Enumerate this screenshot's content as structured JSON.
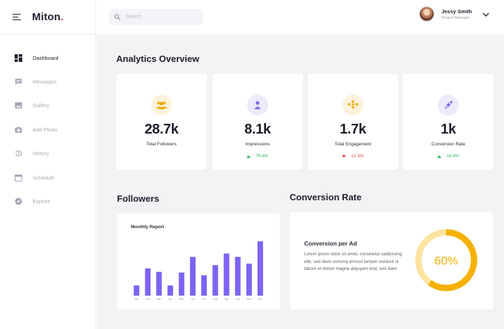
{
  "brand": {
    "name": "Miton",
    "dot": "."
  },
  "sidebar": {
    "items": [
      {
        "label": "Dashboard",
        "icon": "dashboard-icon",
        "active": true
      },
      {
        "label": "Messages",
        "icon": "message-icon",
        "active": false
      },
      {
        "label": "Gallery",
        "icon": "image-icon",
        "active": false
      },
      {
        "label": "Add Photo",
        "icon": "camera-icon",
        "active": false
      },
      {
        "label": "History",
        "icon": "history-icon",
        "active": false
      },
      {
        "label": "Schedule",
        "icon": "calendar-icon",
        "active": false
      },
      {
        "label": "Explore",
        "icon": "compass-icon",
        "active": false
      }
    ]
  },
  "header": {
    "search_placeholder": "Search",
    "user": {
      "name": "Jessy Smith",
      "role": "Project Manager"
    }
  },
  "main": {
    "title": "Analytics Overview",
    "stats": [
      {
        "value": "28.7k",
        "label": "Total Followers",
        "delta": "",
        "trend": "none",
        "icon": "users-icon",
        "icon_bg": "#fdf3dc",
        "icon_color": "#f1b51c"
      },
      {
        "value": "8.1k",
        "label": "Impressions",
        "delta": "78.8%",
        "trend": "up",
        "icon": "person-icon",
        "icon_bg": "#ecebfb",
        "icon_color": "#7b68e8"
      },
      {
        "value": "1.7k",
        "label": "Total Engagement",
        "delta": "12.3%",
        "trend": "down",
        "icon": "group-icon",
        "icon_bg": "#fdf3dc",
        "icon_color": "#f1b51c"
      },
      {
        "value": "1k",
        "label": "Conversion Rate",
        "delta": "18.8%",
        "trend": "up",
        "icon": "rocket-icon",
        "icon_bg": "#ecebfb",
        "icon_color": "#7b68e8"
      }
    ],
    "followers_title": "Followers",
    "conversion_title": "Conversion Rate"
  },
  "chart_data": {
    "type": "bar",
    "title": "Monthly Report",
    "categories": [
      "Jan",
      "Feb",
      "Mar",
      "Apr",
      "May",
      "Jun",
      "Jul",
      "Aug",
      "Sep",
      "Oct",
      "Nov",
      "Dec"
    ],
    "values": [
      15,
      40,
      35,
      15,
      34,
      57,
      30,
      45,
      62,
      57,
      47,
      80
    ],
    "ylim": [
      0,
      85
    ],
    "grid": false,
    "bar_color": "#7e63f4"
  },
  "conversion": {
    "heading": "Conversion per Ad",
    "text": "Lorem ipsum dolor sit amet, consetetur sadipscing elitr, sed diam nonumy eirmod tempor invidunt ut labore et dolore magna aliquyam erat, sed diam",
    "percent": 60,
    "percent_label": "60%",
    "color": "#f5b100",
    "track_color": "#fde4a0"
  },
  "colors": {
    "up": "#2dbd5f",
    "down": "#e74c4c",
    "accent": "#7e63f4",
    "brand_dot": "#e4405f"
  }
}
